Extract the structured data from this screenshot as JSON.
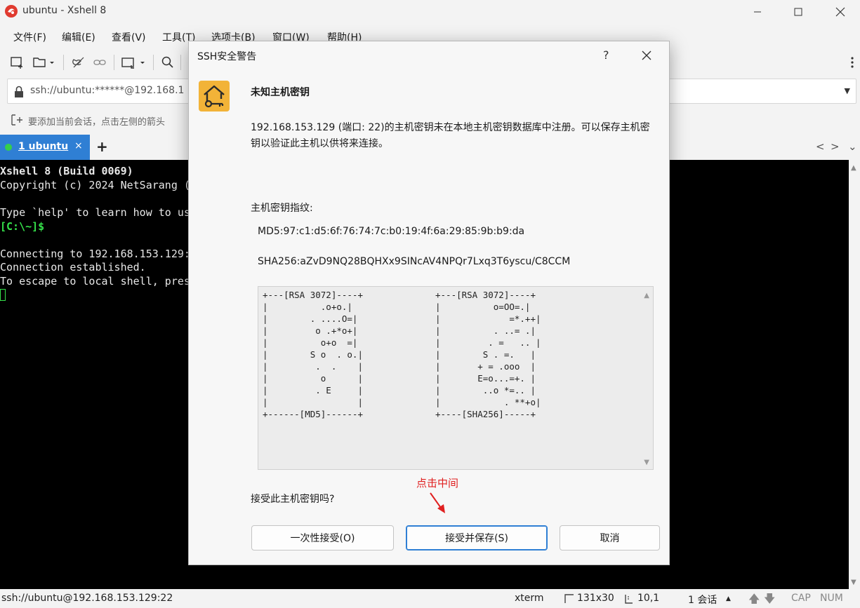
{
  "window": {
    "title": "ubuntu - Xshell 8"
  },
  "menu": [
    "文件(F)",
    "编辑(E)",
    "查看(V)",
    "工具(T)",
    "选项卡(B)",
    "窗口(W)",
    "帮助(H)"
  ],
  "address": {
    "value": "ssh://ubuntu:******@192.168.1"
  },
  "hint": {
    "text": "要添加当前会话，点击左侧的箭头"
  },
  "tab": {
    "label": "1 ubuntu",
    "close": "×",
    "add": "+"
  },
  "terminal": {
    "lines": [
      "Xshell 8 (Build 0069)",
      "Copyright (c) 2024 NetSarang (",
      "",
      "Type `help' to learn how to us",
      "[C:\\~]$",
      "",
      "Connecting to 192.168.153.129:",
      "Connection established.",
      "To escape to local shell, pres"
    ]
  },
  "status": {
    "session": "ssh://ubuntu@192.168.153.129:22",
    "term": "xterm",
    "size": "131x30",
    "pos": "10,1",
    "sessions": "1 会话",
    "cap": "CAP",
    "num": "NUM"
  },
  "dialog": {
    "title": "SSH安全警告",
    "help": "?",
    "heading": "未知主机密钥",
    "description": "192.168.153.129 (端口: 22)的主机密钥未在本地主机密钥数据库中注册。可以保存主机密钥以验证此主机以供将来连接。",
    "fingerprint_label": "主机密钥指纹:",
    "md5": "MD5:97:c1:d5:6f:76:74:7c:b0:19:4f:6a:29:85:9b:b9:da",
    "sha256": "SHA256:aZvD9NQ28BQHXx9SINcAV4NPQr7Lxq3T6yscu/C8CCM",
    "art_md5": "+---[RSA 3072]----+\n|          .o+o.|\n|        . ....O=|\n|         o .+*o+|\n|          o+o  =|\n|        S o  . o.|\n|         .  .    |\n|          o      |\n|         . E     |\n|                 |\n+------[MD5]------+",
    "art_sha": "+---[RSA 3072]----+\n|          o=OO=.|\n|             =*.++|\n|          . ..= .|\n|         . =   .. |\n|        S . =.   |\n|       + = .ooo  |\n|       E=o...=+. |\n|        ..o *=.. |\n|            . **+o|\n+----[SHA256]-----+",
    "question": "接受此主机密钥吗?",
    "annotation": "点击中间",
    "btn_once": "一次性接受(O)",
    "btn_save": "接受并保存(S)",
    "btn_cancel": "取消"
  },
  "colors": {
    "tab_active": "#2f7fd4",
    "prompt": "#35e04a",
    "annotation": "#e02020",
    "key_icon": "#f2b338"
  }
}
